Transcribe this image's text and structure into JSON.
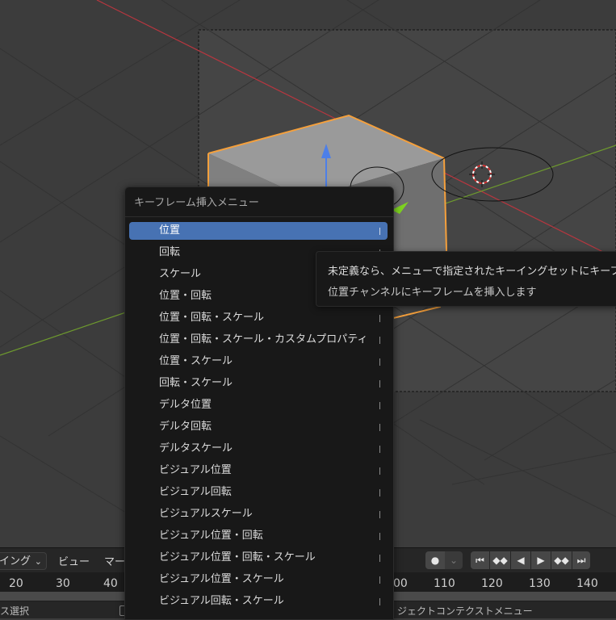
{
  "menu": {
    "title": "キーフレーム挿入メニュー",
    "items": [
      {
        "label": "位置",
        "active": true
      },
      {
        "label": "回転"
      },
      {
        "label": "スケール"
      },
      {
        "label": "位置・回転"
      },
      {
        "label": "位置・回転・スケール"
      },
      {
        "label": "位置・回転・スケール・カスタムプロパティ"
      },
      {
        "label": "位置・スケール"
      },
      {
        "label": "回転・スケール"
      },
      {
        "label": "デルタ位置"
      },
      {
        "label": "デルタ回転"
      },
      {
        "label": "デルタスケール"
      },
      {
        "label": "ビジュアル位置"
      },
      {
        "label": "ビジュアル回転"
      },
      {
        "label": "ビジュアルスケール"
      },
      {
        "label": "ビジュアル位置・回転"
      },
      {
        "label": "ビジュアル位置・回転・スケール"
      },
      {
        "label": "ビジュアル位置・スケール"
      },
      {
        "label": "ビジュアル回転・スケール"
      }
    ]
  },
  "tooltip": {
    "line1": "未定義なら、メニューで指定されたキーイングセットにキーフ",
    "line2": "位置チャンネルにキーフレームを挿入します"
  },
  "timeline": {
    "keying_dropdown": "イング",
    "menu_view": "ビュー",
    "menu_marker": "マー",
    "frame_numbers_left": [
      "20",
      "30",
      "40"
    ],
    "frame_numbers_right": [
      "00",
      "110",
      "120",
      "130",
      "140"
    ],
    "playback": {
      "record_icon": "record-dot-icon",
      "jump_start_icon": "jump-start-icon",
      "prev_keyframe_icon": "prev-keyframe-icon",
      "play_reverse_icon": "play-reverse-icon",
      "play_icon": "play-icon",
      "next_keyframe_icon": "next-keyframe-icon",
      "jump_end_icon": "jump-end-icon"
    }
  },
  "statusbar": {
    "left": "ス選択",
    "right": "ジェクトコンテクストメニュー"
  },
  "colors": {
    "accent": "#4772b3",
    "selection_outline": "#f5a03c",
    "x_axis": "#b8363f",
    "y_axis": "#6e9a2e"
  }
}
